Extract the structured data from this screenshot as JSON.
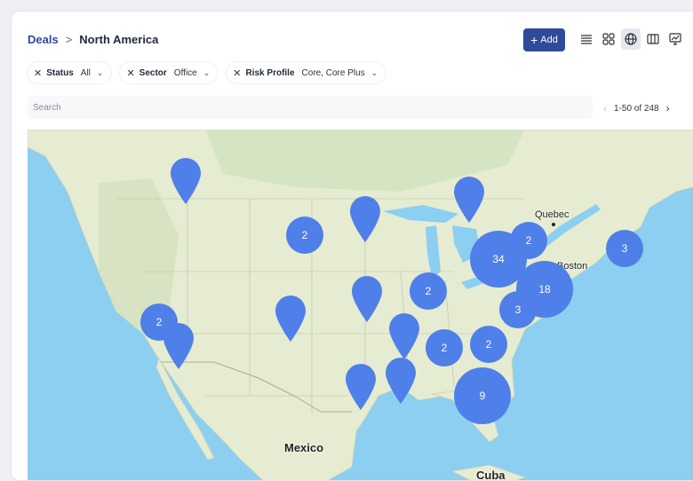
{
  "breadcrumb": {
    "parent": "Deals",
    "separator": ">",
    "current": "North America"
  },
  "toolbar": {
    "add_label": "Add",
    "add_plus": "+",
    "views": [
      {
        "name": "list-view-icon",
        "active": false
      },
      {
        "name": "grid-view-icon",
        "active": false
      },
      {
        "name": "globe-view-icon",
        "active": true
      },
      {
        "name": "columns-view-icon",
        "active": false
      },
      {
        "name": "chart-view-icon",
        "active": false
      }
    ]
  },
  "filters": [
    {
      "label": "Status",
      "value": "All"
    },
    {
      "label": "Sector",
      "value": "Office"
    },
    {
      "label": "Risk Profile",
      "value": "Core, Core Plus"
    }
  ],
  "search": {
    "placeholder": "Search",
    "value": ""
  },
  "pagination": {
    "range": "1-50 of 248"
  },
  "map": {
    "labels": [
      {
        "text": "Quebec"
      },
      {
        "text": "Boston"
      },
      {
        "text": "Mexico"
      },
      {
        "text": "Cuba"
      }
    ],
    "clusters": [
      {
        "count": "2"
      },
      {
        "count": "34"
      },
      {
        "count": "2"
      },
      {
        "count": "3"
      },
      {
        "count": "18"
      },
      {
        "count": "3"
      },
      {
        "count": "2"
      },
      {
        "count": "2"
      },
      {
        "count": "2"
      },
      {
        "count": "2"
      },
      {
        "count": "9"
      }
    ],
    "colors": {
      "water": "#8ccff0",
      "land": "#e6ecd2",
      "marker": "#4f7fe8",
      "accent": "#2d4a9b"
    }
  }
}
